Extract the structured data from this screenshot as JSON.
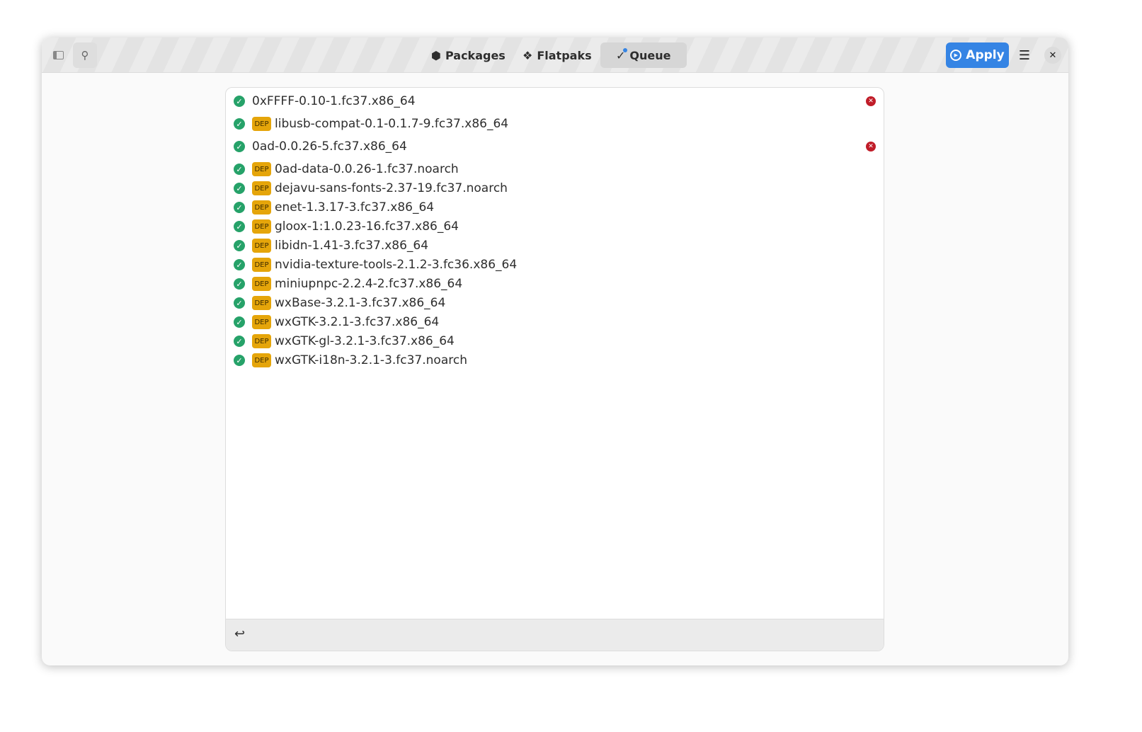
{
  "header": {
    "tabs": [
      {
        "label": "Packages",
        "icon": "package-icon"
      },
      {
        "label": "Flatpaks",
        "icon": "flatpak-icon"
      },
      {
        "label": "Queue",
        "icon": "queue-check-icon",
        "active": true
      }
    ],
    "apply_label": "Apply"
  },
  "queue": [
    {
      "name": "0xFFFF-0.10-1.fc37.x86_64",
      "dep": false,
      "removable": true
    },
    {
      "name": "libusb-compat-0.1-0.1.7-9.fc37.x86_64",
      "dep": true
    },
    {
      "name": "0ad-0.0.26-5.fc37.x86_64",
      "dep": false,
      "removable": true
    },
    {
      "name": "0ad-data-0.0.26-1.fc37.noarch",
      "dep": true
    },
    {
      "name": "dejavu-sans-fonts-2.37-19.fc37.noarch",
      "dep": true
    },
    {
      "name": "enet-1.3.17-3.fc37.x86_64",
      "dep": true
    },
    {
      "name": "gloox-1:1.0.23-16.fc37.x86_64",
      "dep": true
    },
    {
      "name": "libidn-1.41-3.fc37.x86_64",
      "dep": true
    },
    {
      "name": "nvidia-texture-tools-2.1.2-3.fc36.x86_64",
      "dep": true
    },
    {
      "name": "miniupnpc-2.2.4-2.fc37.x86_64",
      "dep": true
    },
    {
      "name": "wxBase-3.2.1-3.fc37.x86_64",
      "dep": true
    },
    {
      "name": "wxGTK-3.2.1-3.fc37.x86_64",
      "dep": true
    },
    {
      "name": "wxGTK-gl-3.2.1-3.fc37.x86_64",
      "dep": true
    },
    {
      "name": "wxGTK-i18n-3.2.1-3.fc37.noarch",
      "dep": true
    }
  ],
  "dep_badge": "DEP",
  "colors": {
    "accent": "#3584e4",
    "check": "#26a269",
    "dep": "#e5a50a",
    "remove": "#c01c28"
  }
}
